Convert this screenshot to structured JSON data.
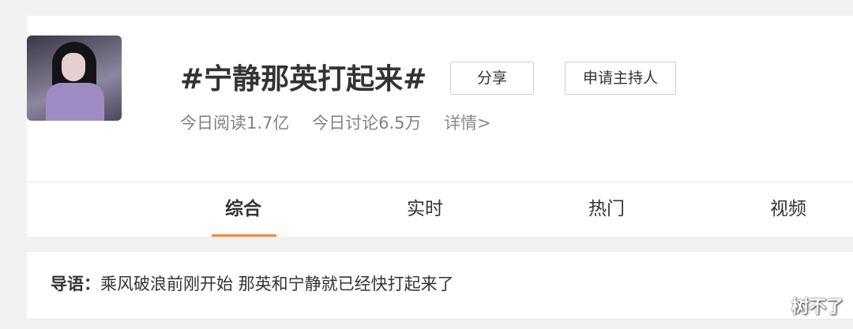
{
  "topic": {
    "title": "#宁静那英打起来#",
    "share_label": "分享",
    "apply_host_label": "申请主持人",
    "reads": "今日阅读1.7亿",
    "discussions": "今日讨论6.5万",
    "details_label": "详情>"
  },
  "tabs": [
    {
      "label": "综合",
      "active": true
    },
    {
      "label": "实时",
      "active": false
    },
    {
      "label": "热门",
      "active": false
    },
    {
      "label": "视频",
      "active": false
    }
  ],
  "guide": {
    "label": "导语：",
    "text": "乘风破浪前刚开始 那英和宁静就已经快打起来了"
  },
  "watermark": "树不了",
  "colors": {
    "accent": "#f7843e",
    "background": "#f1f1f1",
    "text": "#333333",
    "muted": "#808080"
  }
}
